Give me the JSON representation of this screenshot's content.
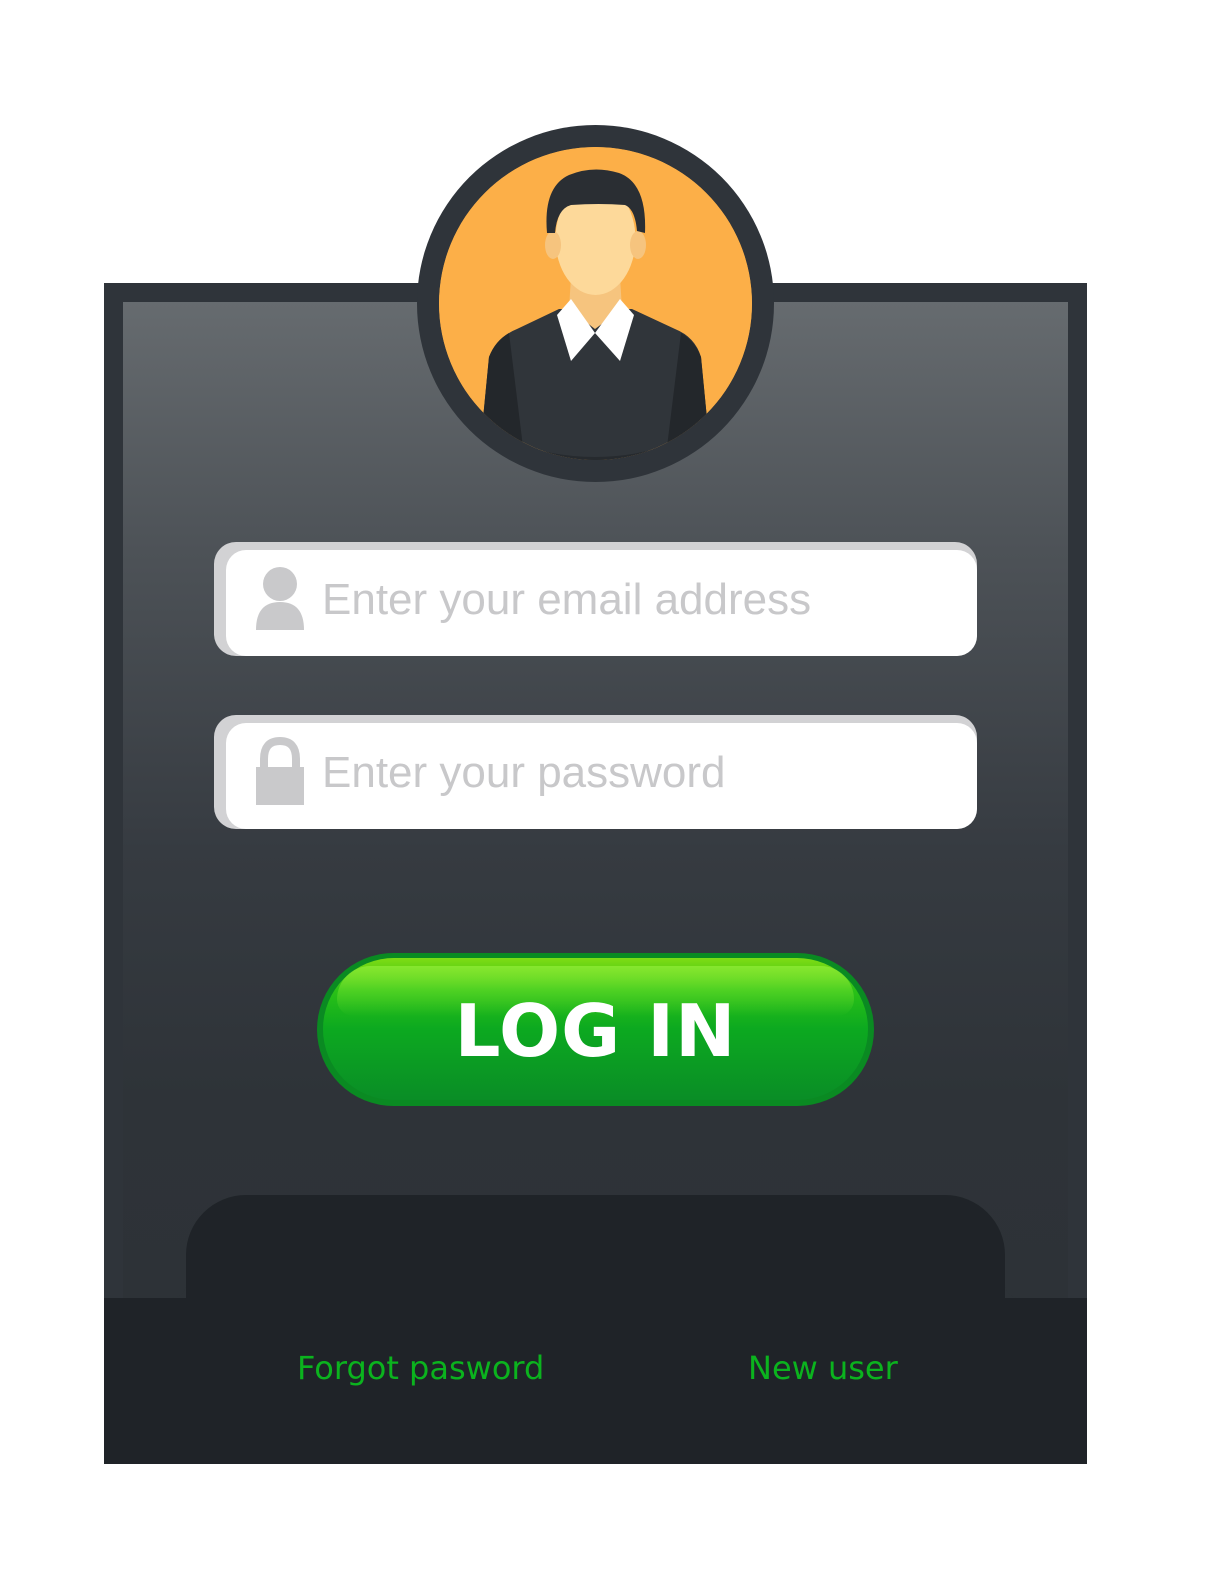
{
  "form": {
    "email_placeholder": "Enter your email address",
    "password_placeholder": "Enter your password",
    "login_label": "LOG IN"
  },
  "footer": {
    "forgot_label": "Forgot pasword",
    "new_user_label": "New user"
  },
  "colors": {
    "accent": "#0bb31e",
    "avatar_background": "#fcaf48",
    "card": "#2f343a",
    "footer": "#1f2328"
  },
  "icons": {
    "avatar": "user-avatar-icon",
    "email": "user-icon",
    "password": "lock-icon"
  }
}
